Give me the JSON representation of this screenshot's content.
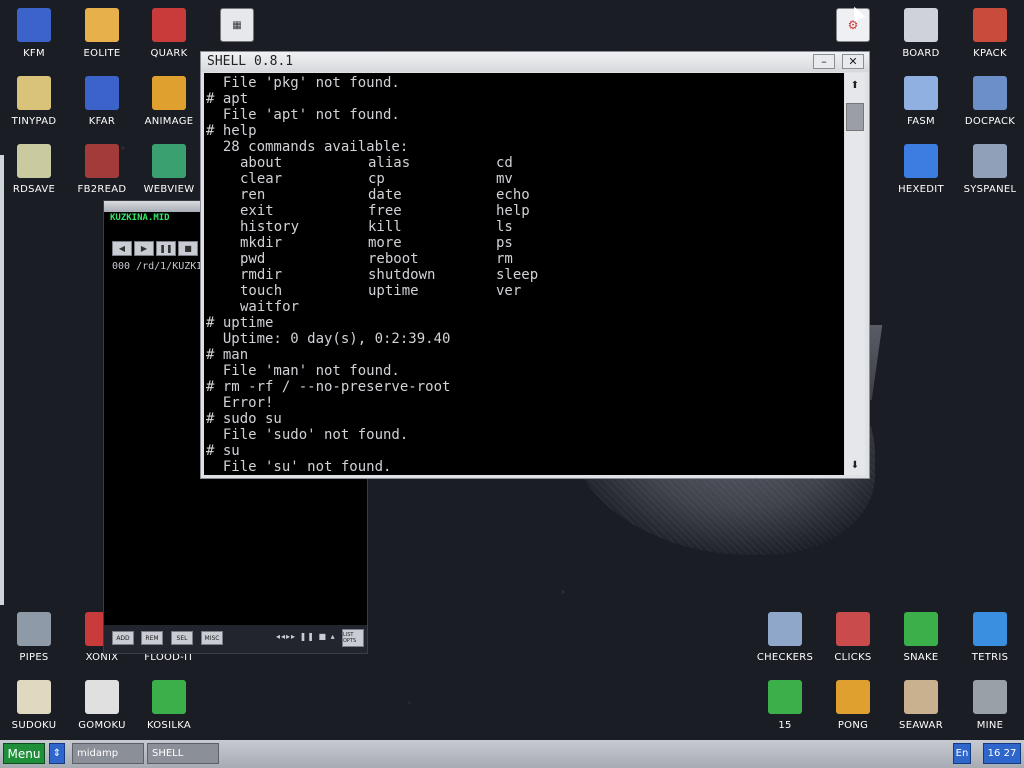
{
  "desktop": {
    "icons_top_left": [
      {
        "label": "KFM",
        "icon": "floppy-disk-icon",
        "color": "#3b63c9"
      },
      {
        "label": "EOLITE",
        "icon": "folder-icon",
        "color": "#e8b04a"
      },
      {
        "label": "QUARK",
        "icon": "book-icon",
        "color": "#c93b3b"
      },
      {
        "label": "TINYPAD",
        "icon": "notepad-icon",
        "color": "#d9c37a"
      },
      {
        "label": "KFAR",
        "icon": "archive-icon",
        "color": "#3b63c9"
      },
      {
        "label": "ANIMAGE",
        "icon": "brush-icon",
        "color": "#e0a030"
      },
      {
        "label": "RDSAVE",
        "icon": "disk-save-icon",
        "color": "#c9caa0"
      },
      {
        "label": "FB2READ",
        "icon": "fb2-book-icon",
        "color": "#a33b3b"
      },
      {
        "label": "WEBVIEW",
        "icon": "globe-icon",
        "color": "#3aa070"
      }
    ],
    "icons_top_right": [
      {
        "label": "BOARD",
        "icon": "board-icon",
        "color": "#cfd2d8"
      },
      {
        "label": "KPACK",
        "icon": "hammer-icon",
        "color": "#c94b3b"
      },
      {
        "label": "FASM",
        "icon": "fasm-icon",
        "color": "#8fb0e0"
      },
      {
        "label": "DOCPACK",
        "icon": "docpack-icon",
        "color": "#6d8fc9"
      },
      {
        "label": "HEXEDIT",
        "icon": "hexedit-icon",
        "color": "#3b7de0"
      },
      {
        "label": "SYSPANEL",
        "icon": "syspanel-icon",
        "color": "#8fa0b8"
      }
    ],
    "icons_bottom_left": [
      {
        "label": "PIPES",
        "icon": "pipes-icon",
        "color": "#8f9aa8"
      },
      {
        "label": "XONIX",
        "icon": "xonix-icon",
        "color": "#c93b3b"
      },
      {
        "label": "FLOOD-IT",
        "icon": "flood-icon",
        "color": "#3ba0c9"
      },
      {
        "label": "SUDOKU",
        "icon": "sudoku-icon",
        "color": "#e0d8c0"
      },
      {
        "label": "GOMOKU",
        "icon": "gomoku-icon",
        "color": "#e0e0e0"
      },
      {
        "label": "KOSILKA",
        "icon": "mower-icon",
        "color": "#3bb04a"
      }
    ],
    "icons_bottom_right": [
      {
        "label": "CHECKERS",
        "icon": "checkers-icon",
        "color": "#8fa8c9"
      },
      {
        "label": "CLICKS",
        "icon": "clicks-icon",
        "color": "#c94b4b"
      },
      {
        "label": "SNAKE",
        "icon": "snake-icon",
        "color": "#3bb04a"
      },
      {
        "label": "TETRIS",
        "icon": "tetris-icon",
        "color": "#3b8fe0"
      },
      {
        "label": "15",
        "icon": "fifteen-icon",
        "color": "#3bb04a"
      },
      {
        "label": "PONG",
        "icon": "pong-icon",
        "color": "#e0a030"
      },
      {
        "label": "SEAWAR",
        "icon": "seawar-icon",
        "color": "#c9b08f"
      },
      {
        "label": "MINE",
        "icon": "mine-icon",
        "color": "#9aa0a8"
      }
    ],
    "calc_icon": {
      "label": "",
      "icon": "calculator-icon"
    },
    "system_icon": {
      "label": "",
      "icon": "system-tray-icon"
    }
  },
  "midamp": {
    "title": "KUZKINA.MID",
    "track_line": "000 /rd/1/KUZKI",
    "controls": [
      "◀",
      "▶",
      "❚❚",
      "■"
    ],
    "bottom_buttons": [
      "ADD",
      "REM",
      "SEL",
      "MISC"
    ],
    "transport": "◂◂▸▸ ❚❚ ■ ▴",
    "list_button": "LIST OPTS"
  },
  "shell": {
    "title": "SHELL 0.8.1",
    "minimize": "–",
    "close": "✕",
    "scroll_up": "⬆",
    "scroll_down": "⬇",
    "lines_before": [
      "  File 'pkg' not found.",
      "# apt",
      "  File 'apt' not found.",
      "# help",
      "  28 commands available:"
    ],
    "commands": [
      [
        "about",
        "alias",
        "cd"
      ],
      [
        "clear",
        "cp",
        "mv"
      ],
      [
        "ren",
        "date",
        "echo"
      ],
      [
        "exit",
        "free",
        "help"
      ],
      [
        "history",
        "kill",
        "ls"
      ],
      [
        "mkdir",
        "more",
        "ps"
      ],
      [
        "pwd",
        "reboot",
        "rm"
      ],
      [
        "rmdir",
        "shutdown",
        "sleep"
      ],
      [
        "touch",
        "uptime",
        "ver"
      ],
      [
        "waitfor",
        "",
        ""
      ]
    ],
    "lines_after": [
      "# uptime",
      "  Uptime: 0 day(s), 0:2:39.40",
      "# man",
      "  File 'man' not found.",
      "# rm -rf / --no-preserve-root",
      "  Error!",
      "# sudo su",
      "  File 'sudo' not found.",
      "# su",
      "  File 'su' not found."
    ]
  },
  "taskbar": {
    "menu": "Menu",
    "switch": "⇕",
    "tasks": [
      "midamp",
      "SHELL"
    ],
    "lang": "En",
    "time": "16 27"
  }
}
